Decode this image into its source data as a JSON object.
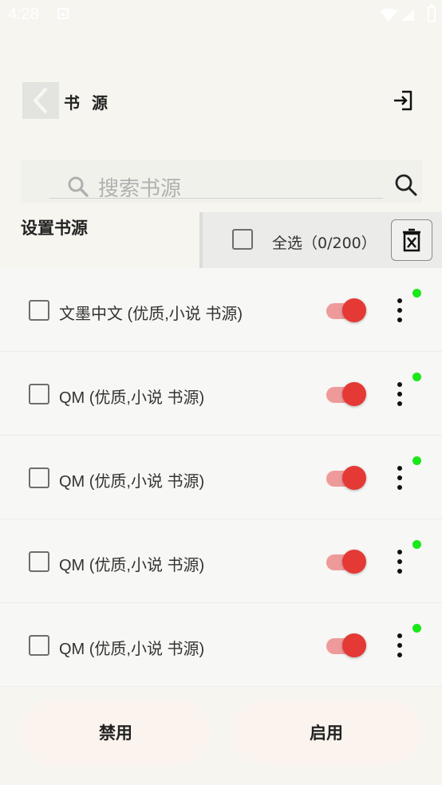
{
  "status_bar": {
    "time": "4:28"
  },
  "toolbar": {
    "title": "书 源",
    "back_icon": "chevron-left-icon",
    "import_icon": "import-icon"
  },
  "search": {
    "placeholder": "搜索书源"
  },
  "section": {
    "title": "设置书源"
  },
  "selection": {
    "label": "全选（0/200）",
    "delete_icon": "delete-all-icon"
  },
  "sources": [
    {
      "name": "文墨中文 (优质,小说 书源)",
      "checked": false,
      "enabled": true,
      "status_color": "#19e819"
    },
    {
      "name": "QM (优质,小说 书源)",
      "checked": false,
      "enabled": true,
      "status_color": "#19e819"
    },
    {
      "name": "QM (优质,小说 书源)",
      "checked": false,
      "enabled": true,
      "status_color": "#19e819"
    },
    {
      "name": "QM (优质,小说 书源)",
      "checked": false,
      "enabled": true,
      "status_color": "#19e819"
    },
    {
      "name": "QM (优质,小说 书源)",
      "checked": false,
      "enabled": true,
      "status_color": "#19e819"
    }
  ],
  "actions": {
    "disable_label": "禁用",
    "enable_label": "启用"
  },
  "colors": {
    "accent": "#e53935",
    "switch_track": "#ef9a9a",
    "status_ok": "#19e819"
  }
}
